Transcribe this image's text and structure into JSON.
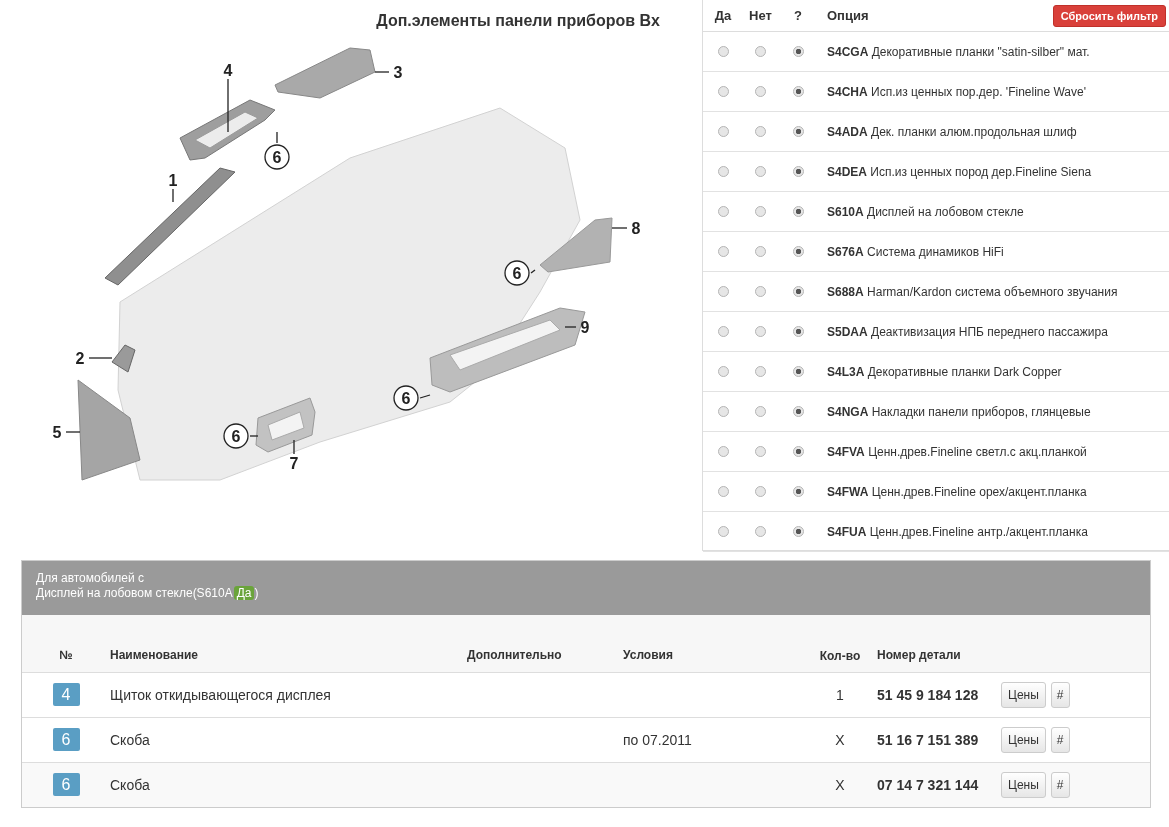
{
  "diagram": {
    "title": "Доп.элементы панели приборов Bx",
    "callouts": [
      {
        "label": "4",
        "circled": false
      },
      {
        "label": "3",
        "circled": false
      },
      {
        "label": "6",
        "circled": true
      },
      {
        "label": "1",
        "circled": false
      },
      {
        "label": "8",
        "circled": false
      },
      {
        "label": "6",
        "circled": true
      },
      {
        "label": "9",
        "circled": false
      },
      {
        "label": "2",
        "circled": false
      },
      {
        "label": "6",
        "circled": true
      },
      {
        "label": "5",
        "circled": false
      },
      {
        "label": "6",
        "circled": true
      },
      {
        "label": "7",
        "circled": false
      }
    ]
  },
  "options": {
    "columns": [
      "Да",
      "Нет",
      "?",
      "Опция"
    ],
    "reset_button": "Сбросить фильтр",
    "rows": [
      {
        "code": "S4CGA",
        "text": "Декоративные планки \"satin-silber\" мат.",
        "radios": [
          {
            "selected": false
          },
          {
            "selected": false
          },
          {
            "selected": true
          }
        ]
      },
      {
        "code": "S4CHA",
        "text": "Исп.из ценных пор.дер. 'Fineline Wave'",
        "radios": [
          {
            "selected": false
          },
          {
            "selected": false
          },
          {
            "selected": true
          }
        ]
      },
      {
        "code": "S4ADA",
        "text": "Дек. планки алюм.продольная шлиф",
        "radios": [
          {
            "selected": false
          },
          {
            "selected": false
          },
          {
            "selected": true
          }
        ]
      },
      {
        "code": "S4DEA",
        "text": "Исп.из ценных пород дер.Fineline Siena",
        "radios": [
          {
            "selected": false
          },
          {
            "selected": false
          },
          {
            "selected": true
          }
        ]
      },
      {
        "code": "S610A",
        "text": "Дисплей на лобовом стекле",
        "radios": [
          {
            "selected": false
          },
          {
            "selected": false
          },
          {
            "selected": true
          }
        ]
      },
      {
        "code": "S676A",
        "text": "Система динамиков HiFi",
        "radios": [
          {
            "selected": false
          },
          {
            "selected": false
          },
          {
            "selected": true
          }
        ]
      },
      {
        "code": "S688A",
        "text": "Harman/Kardon система объемного звучания",
        "radios": [
          {
            "selected": false
          },
          {
            "selected": false
          },
          {
            "selected": true
          }
        ]
      },
      {
        "code": "S5DAA",
        "text": "Деактивизация НПБ переднего пассажира",
        "radios": [
          {
            "selected": false
          },
          {
            "selected": false
          },
          {
            "selected": true
          }
        ]
      },
      {
        "code": "S4L3A",
        "text": "Декоративные планки Dark Copper",
        "radios": [
          {
            "selected": false
          },
          {
            "selected": false
          },
          {
            "selected": true
          }
        ]
      },
      {
        "code": "S4NGA",
        "text": "Накладки панели приборов, глянцевые",
        "radios": [
          {
            "selected": false
          },
          {
            "selected": false
          },
          {
            "selected": true
          }
        ]
      },
      {
        "code": "S4FVA",
        "text": "Ценн.древ.Fineline светл.с акц.планкой",
        "radios": [
          {
            "selected": false
          },
          {
            "selected": false
          },
          {
            "selected": true
          }
        ]
      },
      {
        "code": "S4FWA",
        "text": "Ценн.древ.Fineline орех/акцент.планка",
        "radios": [
          {
            "selected": false
          },
          {
            "selected": false
          },
          {
            "selected": true
          }
        ]
      },
      {
        "code": "S4FUA",
        "text": "Ценн.древ.Fineline антр./акцент.планка",
        "radios": [
          {
            "selected": false
          },
          {
            "selected": false
          },
          {
            "selected": true
          }
        ]
      }
    ]
  },
  "parts": {
    "header_line1": "Для автомобилей с",
    "header_line2": "Дисплей на лобовом стекле(S610A",
    "header_badge": "Да",
    "header_end": ")",
    "columns": [
      "№",
      "Наименование",
      "Дополнительно",
      "Условия",
      "Кол-во",
      "Номер детали"
    ],
    "rows": [
      {
        "number": "4",
        "name": "Щиток откидывающегося дисплея",
        "conditions": "",
        "qty": "1",
        "part_number": "51 45 9 184 128",
        "buttons": [
          "Цены",
          "#"
        ]
      },
      {
        "number": "6",
        "name": "Скоба",
        "conditions": "по 07.2011",
        "qty": "X",
        "part_number": "51 16 7 151 389",
        "buttons": [
          "Цены",
          "#"
        ]
      },
      {
        "number": "6",
        "name": "Скоба",
        "conditions": "",
        "qty": "X",
        "part_number": "07 14 7 321 144",
        "buttons": [
          "Цены",
          "#"
        ]
      }
    ]
  }
}
